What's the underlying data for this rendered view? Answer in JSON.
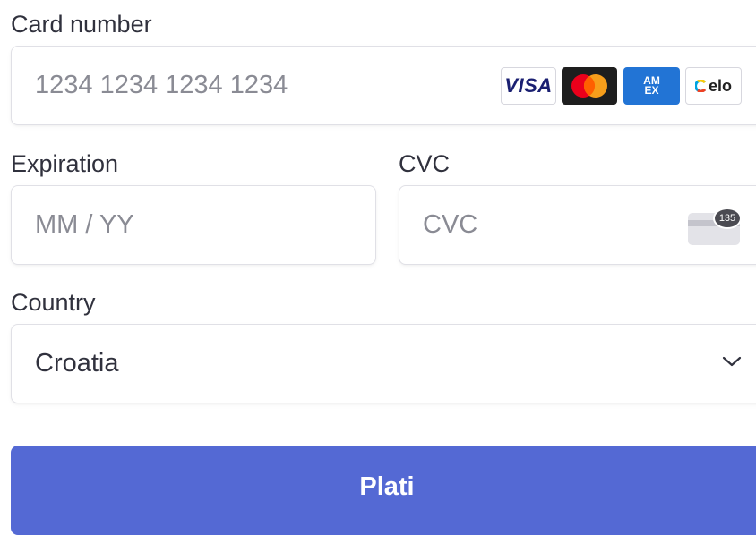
{
  "card_number": {
    "label": "Card number",
    "placeholder": "1234 1234 1234 1234",
    "brand_icons": [
      "visa-icon",
      "mastercard-icon",
      "amex-icon",
      "elo-icon"
    ],
    "brand_text": {
      "visa": "VISA",
      "amex": "AM EX",
      "elo": "elo"
    }
  },
  "expiration": {
    "label": "Expiration",
    "placeholder": "MM / YY"
  },
  "cvc": {
    "label": "CVC",
    "placeholder": "CVC",
    "icon_badge": "135"
  },
  "country": {
    "label": "Country",
    "selected": "Croatia"
  },
  "submit": {
    "label": "Plati"
  },
  "colors": {
    "accent": "#5469d4",
    "text": "#30313d",
    "placeholder": "#8a8b94",
    "border": "#e0e0e6"
  }
}
